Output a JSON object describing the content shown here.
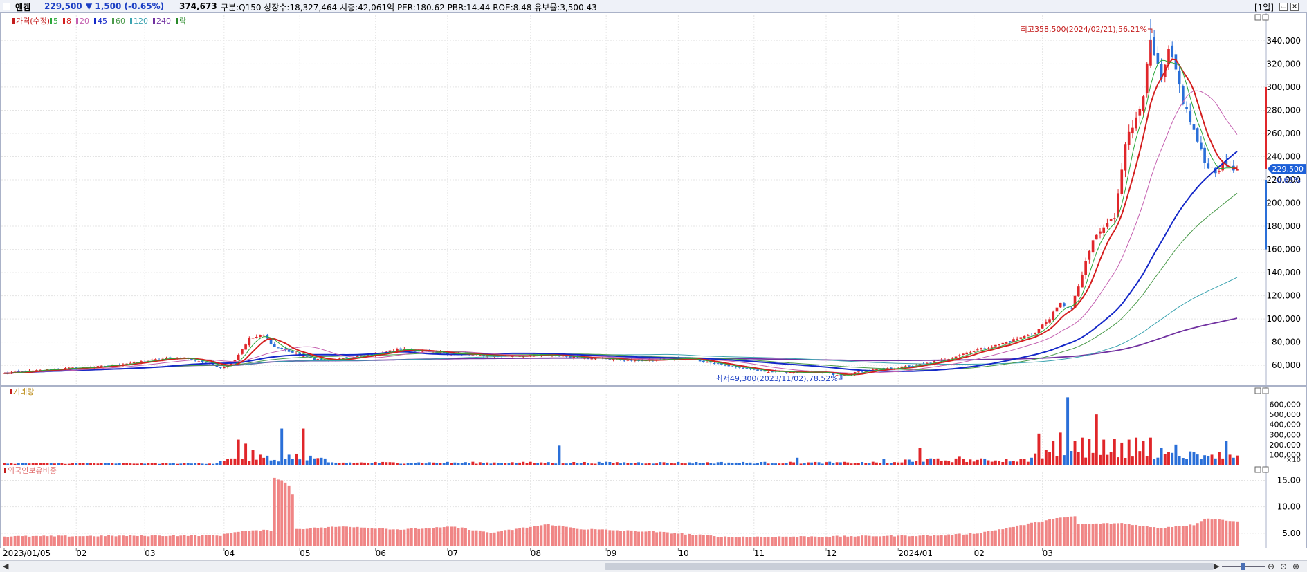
{
  "header": {
    "stock_name": "엔켐",
    "price": "229,500",
    "change": "▼ 1,500 (-0.65%)",
    "volume": "374,673",
    "stats": "구분:Q150 상장수:18,327,464 시총:42,061억 PER:180.62 PBR:14.44 ROE:8.48 유보율:3,500.43",
    "period": "[1일]"
  },
  "colors": {
    "up": "#e0262a",
    "down": "#2a6fd8",
    "ma5": "#2aa83a",
    "ma8": "#d41f1f",
    "ma20": "#c460b0",
    "ma45": "#1428c8",
    "ma60": "#4a9a4a",
    "ma120": "#3aa3b0",
    "ma240": "#7030a0",
    "foreign": "#f08585"
  },
  "chart_data": [
    {
      "type": "candlestick",
      "legend": [
        "가격(수정)",
        "5",
        "8",
        "20",
        "45",
        "60",
        "120",
        "240",
        "락"
      ],
      "x_tick_labels": [
        "2023/01/05",
        "02",
        "03",
        "04",
        "05",
        "06",
        "07",
        "08",
        "09",
        "10",
        "11",
        "12",
        "2024/01",
        "02",
        "03"
      ],
      "y_tick_labels": [
        "60,000",
        "80,000",
        "100,000",
        "120,000",
        "140,000",
        "160,000",
        "180,000",
        "200,000",
        "220,000",
        "240,000",
        "260,000",
        "280,000",
        "300,000",
        "320,000",
        "340,000"
      ],
      "ylim": [
        44000,
        362000
      ],
      "annotations": {
        "high": "최고358,500(2024/02/21),56.21%",
        "low": "최저49,300(2023/11/02),78.52%"
      },
      "last_price_label": "229,500",
      "last_change_label": "-0.65%",
      "close_anchors": [
        [
          0,
          53000
        ],
        [
          15,
          57000
        ],
        [
          25,
          58500
        ],
        [
          35,
          62000
        ],
        [
          45,
          66000
        ],
        [
          50,
          66500
        ],
        [
          57,
          61500
        ],
        [
          60,
          58500
        ],
        [
          62,
          60000
        ],
        [
          64,
          65000
        ],
        [
          68,
          83000
        ],
        [
          72,
          86000
        ],
        [
          75,
          76000
        ],
        [
          80,
          71000
        ],
        [
          85,
          66000
        ],
        [
          90,
          64000
        ],
        [
          100,
          68500
        ],
        [
          110,
          74000
        ],
        [
          120,
          71000
        ],
        [
          130,
          69000
        ],
        [
          140,
          68000
        ],
        [
          150,
          69000
        ],
        [
          158,
          67500
        ],
        [
          165,
          66000
        ],
        [
          175,
          64000
        ],
        [
          182,
          65000
        ],
        [
          190,
          66000
        ],
        [
          200,
          60000
        ],
        [
          210,
          55000
        ],
        [
          220,
          54000
        ],
        [
          228,
          53500
        ],
        [
          232,
          50500
        ],
        [
          238,
          55000
        ],
        [
          248,
          58000
        ],
        [
          255,
          61000
        ],
        [
          262,
          66000
        ],
        [
          268,
          72000
        ],
        [
          275,
          77000
        ],
        [
          280,
          82000
        ],
        [
          286,
          88000
        ],
        [
          290,
          101000
        ],
        [
          293,
          113000
        ],
        [
          296,
          109000
        ],
        [
          299,
          138000
        ],
        [
          302,
          168000
        ],
        [
          305,
          179000
        ],
        [
          308,
          188000
        ],
        [
          311,
          253000
        ],
        [
          313,
          265000
        ],
        [
          316,
          295000
        ],
        [
          318,
          338000
        ],
        [
          321,
          305000
        ],
        [
          323,
          330000
        ],
        [
          325,
          314000
        ],
        [
          327,
          288000
        ],
        [
          330,
          262000
        ],
        [
          333,
          235000
        ],
        [
          336,
          228000
        ],
        [
          339,
          233000
        ],
        [
          342,
          229500
        ]
      ],
      "ma_last_values": {
        "ma5": 235000,
        "ma8": 238000,
        "ma20": 271000,
        "ma45": 212000,
        "ma60": 180000,
        "ma120": 120000,
        "ma240": 94000
      }
    },
    {
      "type": "bar",
      "title": "거래량",
      "y_tick_labels": [
        "100,000",
        "200,000",
        "300,000",
        "400,000",
        "500,000",
        "600,000"
      ],
      "unit_label": "×10",
      "ylim": [
        0,
        700000
      ],
      "spikes": [
        [
          65,
          250000
        ],
        [
          67,
          210000
        ],
        [
          69,
          150000
        ],
        [
          71,
          100000
        ],
        [
          73,
          90000
        ],
        [
          77,
          360000
        ],
        [
          79,
          100000
        ],
        [
          81,
          110000
        ],
        [
          83,
          360000
        ],
        [
          85,
          90000
        ],
        [
          154,
          190000
        ],
        [
          220,
          70000
        ],
        [
          244,
          60000
        ],
        [
          254,
          170000
        ],
        [
          265,
          80000
        ],
        [
          285,
          70000
        ],
        [
          287,
          310000
        ],
        [
          289,
          150000
        ],
        [
          291,
          240000
        ],
        [
          293,
          320000
        ],
        [
          295,
          670000
        ],
        [
          297,
          240000
        ],
        [
          299,
          270000
        ],
        [
          301,
          260000
        ],
        [
          303,
          500000
        ],
        [
          305,
          250000
        ],
        [
          308,
          260000
        ],
        [
          310,
          220000
        ],
        [
          312,
          250000
        ],
        [
          314,
          270000
        ],
        [
          316,
          240000
        ],
        [
          318,
          270000
        ],
        [
          321,
          170000
        ],
        [
          323,
          130000
        ],
        [
          325,
          200000
        ],
        [
          335,
          100000
        ],
        [
          339,
          240000
        ],
        [
          341,
          70000
        ]
      ]
    },
    {
      "type": "bar",
      "title": "외국인보유비중",
      "y_tick_labels": [
        "5.00",
        "10.00",
        "15.00"
      ],
      "ylim": [
        2.5,
        16.5
      ],
      "anchors": [
        [
          0,
          4.4
        ],
        [
          60,
          4.6
        ],
        [
          64,
          5.3
        ],
        [
          74,
          5.6
        ],
        [
          75,
          15.5
        ],
        [
          77,
          15.0
        ],
        [
          79,
          14.0
        ],
        [
          80,
          12.5
        ],
        [
          81,
          5.8
        ],
        [
          95,
          6.3
        ],
        [
          110,
          5.7
        ],
        [
          125,
          6.2
        ],
        [
          135,
          5.1
        ],
        [
          151,
          6.7
        ],
        [
          160,
          5.8
        ],
        [
          180,
          5.3
        ],
        [
          200,
          4.3
        ],
        [
          230,
          4.4
        ],
        [
          260,
          4.6
        ],
        [
          270,
          5.0
        ],
        [
          280,
          6.2
        ],
        [
          290,
          7.6
        ],
        [
          297,
          8.2
        ],
        [
          298,
          6.7
        ],
        [
          310,
          6.9
        ],
        [
          320,
          6.0
        ],
        [
          330,
          6.6
        ],
        [
          333,
          7.8
        ],
        [
          342,
          7.3
        ]
      ]
    }
  ]
}
